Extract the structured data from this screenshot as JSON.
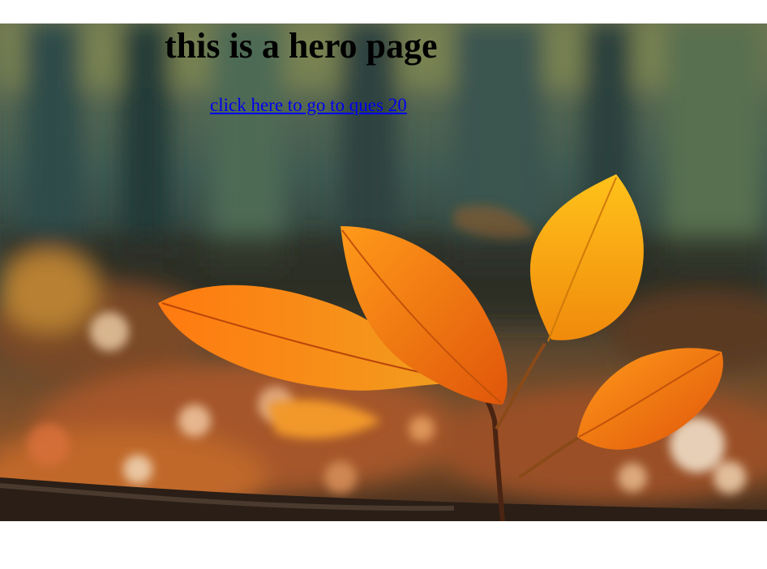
{
  "hero": {
    "title": "this is a hero page",
    "link_text": "click here to go to ques 20",
    "image": "autumn-leaves-photo"
  },
  "colors": {
    "link": "#0000ee",
    "title": "#000000",
    "page_background": "#ffffff"
  }
}
